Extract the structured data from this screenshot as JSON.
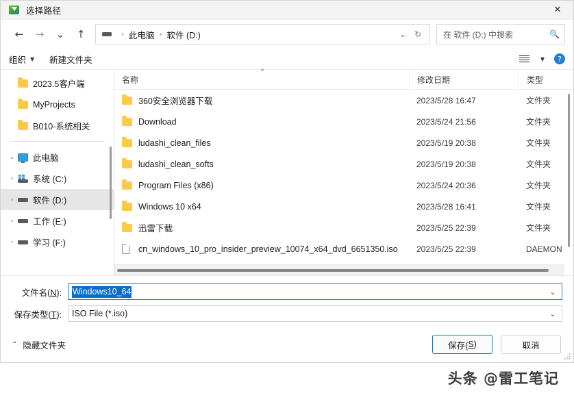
{
  "window": {
    "title": "选择路径",
    "app_icon": "save-arrow-icon",
    "close_label": "✕"
  },
  "nav": {
    "back_label": "←",
    "forward_label": "→",
    "recent_label": "⌄",
    "up_label": "↑",
    "address": {
      "drive_icon": "drive-icon",
      "crumbs": [
        "此电脑",
        "软件 (D:)"
      ],
      "separator": "›",
      "history_label": "⌄",
      "refresh_label": "↻"
    },
    "search": {
      "placeholder": "在 软件 (D:) 中搜索",
      "icon": "search-icon"
    }
  },
  "toolbar": {
    "organize_label": "组织",
    "organize_caret": "▼",
    "new_folder_label": "新建文件夹",
    "view_caret": "▼",
    "help_label": "?"
  },
  "sidebar": {
    "items": [
      {
        "label": "2023.5客户端",
        "icon": "folder-icon",
        "indent": 1,
        "chevron": "",
        "selected": false
      },
      {
        "label": "MyProjects",
        "icon": "folder-icon",
        "indent": 1,
        "chevron": "",
        "selected": false
      },
      {
        "label": "B010-系统相关",
        "icon": "folder-icon",
        "indent": 1,
        "chevron": "",
        "selected": false
      },
      {
        "label": "此电脑",
        "icon": "pc-icon",
        "indent": 0,
        "chevron": "⌄",
        "selected": false
      },
      {
        "label": "系统 (C:)",
        "icon": "system-drive-icon",
        "indent": 1,
        "chevron": "›",
        "selected": false
      },
      {
        "label": "软件 (D:)",
        "icon": "drive-icon",
        "indent": 1,
        "chevron": "›",
        "selected": true
      },
      {
        "label": "工作 (E:)",
        "icon": "drive-icon",
        "indent": 1,
        "chevron": "›",
        "selected": false
      },
      {
        "label": "学习 (F:)",
        "icon": "drive-icon",
        "indent": 1,
        "chevron": "›",
        "selected": false
      }
    ]
  },
  "filelist": {
    "columns": {
      "name": "名称",
      "date": "修改日期",
      "type": "类型"
    },
    "sort_caret": "⌃",
    "rows": [
      {
        "name": "360安全浏览器下载",
        "date": "2023/5/28 16:47",
        "type": "文件夹",
        "icon": "folder-icon"
      },
      {
        "name": "Download",
        "date": "2023/5/24 21:56",
        "type": "文件夹",
        "icon": "folder-icon"
      },
      {
        "name": "ludashi_clean_files",
        "date": "2023/5/19 20:38",
        "type": "文件夹",
        "icon": "folder-icon"
      },
      {
        "name": "ludashi_clean_softs",
        "date": "2023/5/19 20:38",
        "type": "文件夹",
        "icon": "folder-icon"
      },
      {
        "name": "Program Files (x86)",
        "date": "2023/5/24 20:36",
        "type": "文件夹",
        "icon": "folder-icon"
      },
      {
        "name": "Windows 10 x64",
        "date": "2023/5/28 16:41",
        "type": "文件夹",
        "icon": "folder-icon"
      },
      {
        "name": "迅雷下载",
        "date": "2023/5/25 22:39",
        "type": "文件夹",
        "icon": "folder-icon"
      },
      {
        "name": "cn_windows_10_pro_insider_preview_10074_x64_dvd_6651350.iso",
        "date": "2023/5/25 22:39",
        "type": "DAEMON",
        "icon": "file-icon"
      }
    ]
  },
  "form": {
    "filename_label_pre": "文件名(",
    "filename_label_key": "N",
    "filename_label_post": "):",
    "filename_value": "Windows10_64",
    "filetype_label_pre": "保存类型(",
    "filetype_label_key": "T",
    "filetype_label_post": "):",
    "filetype_value": "ISO File (*.iso)",
    "chevron": "⌄"
  },
  "actions": {
    "hide_folders_chevron": "⌃",
    "hide_folders_label": "隐藏文件夹",
    "save_label_pre": "保存(",
    "save_label_key": "S",
    "save_label_post": ")",
    "cancel_label": "取消"
  },
  "watermark": {
    "text": "头条 @雷工笔记"
  },
  "colors": {
    "accent": "#0a6cce",
    "focus_border": "#1f7fd0",
    "selection": "#e6e6e6",
    "folder": "#fcc94b"
  }
}
